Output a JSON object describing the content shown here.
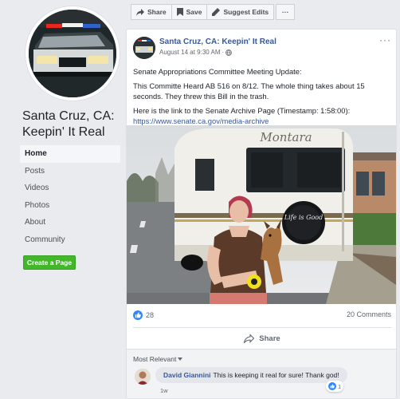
{
  "page": {
    "name": "Santa Cruz, CA:\nKeepin' It Real"
  },
  "nav": {
    "items": [
      "Home",
      "Posts",
      "Videos",
      "Photos",
      "About",
      "Community"
    ],
    "active": "Home"
  },
  "create_page_label": "Create a Page",
  "actions": {
    "share": "Share",
    "save": "Save",
    "suggest": "Suggest Edits",
    "more": "···"
  },
  "post": {
    "author": "Santa Cruz, CA: Keepin' It Real",
    "timestamp": "August 14 at 9:30 AM",
    "privacy_icon": "globe-icon",
    "line1": "Senate Appropriations Committee Meeting Update:",
    "line2": "This Committe Heard AB 516 on 8/12. The whole thing takes about 15 seconds. They threw this Bill in the trash.",
    "line3": "Here is the link to the Senate Archive Page (Timestamp: 1:58:00):",
    "link": "https://www.senate.ca.gov/media-archive",
    "rv_brand": "Montara",
    "tire_cover_text": "Life is Good",
    "likes": "28",
    "comments": "20 Comments",
    "share_label": "Share",
    "menu": "···"
  },
  "comments": {
    "sort_label": "Most Relevant",
    "items": [
      {
        "author": "David Giannini",
        "text": "This is keeping it real for sure! Thank god!",
        "time": "1w",
        "likes": "1"
      }
    ]
  },
  "colors": {
    "link": "#385898",
    "create_button": "#42b72a",
    "like_blue": "#2d88ff",
    "background": "#e9ebee"
  }
}
